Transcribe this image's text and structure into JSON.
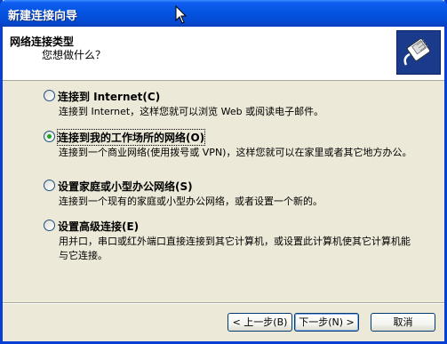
{
  "window": {
    "title": "新建连接向导"
  },
  "header": {
    "title": "网络连接类型",
    "subtitle": "您想做什么？"
  },
  "options": [
    {
      "label": "连接到 Internet(C)",
      "description": "连接到 Internet，这样您就可以浏览 Web 或阅读电子邮件。",
      "checked": false
    },
    {
      "label": "连接到我的工作场所的网络(O)",
      "description": "连接到一个商业网络(使用拨号或 VPN)，这样您就可以在家里或者其它地方办公。",
      "checked": true
    },
    {
      "label": "设置家庭或小型办公网络(S)",
      "description": "连接到一个现有的家庭或小型办公网络，或者设置一个新的。",
      "checked": false
    },
    {
      "label": "设置高级连接(E)",
      "description": "用并口，串口或红外端口直接连接到其它计算机，或设置此计算机使其它计算机能与它连接。",
      "checked": false
    }
  ],
  "buttons": {
    "back": "< 上一步(B)",
    "next": "下一步(N) >",
    "cancel": "取消"
  },
  "icons": {
    "header_icon": "network-cable-plug-icon",
    "cursor": "mouse-pointer-icon"
  },
  "colors": {
    "titlebar": "#0453e0",
    "face": "#ece9d8",
    "radio_checked": "#21a121"
  }
}
